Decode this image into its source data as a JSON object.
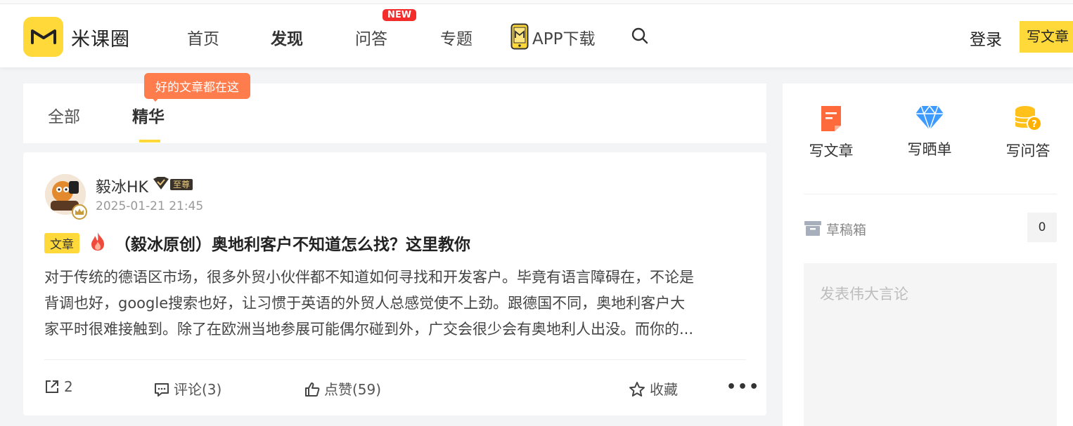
{
  "header": {
    "app_name": "米课圈",
    "nav": [
      "首页",
      "发现",
      "问答",
      "专题"
    ],
    "new_badge": "NEW",
    "app_download": "APP下载",
    "login": "登录",
    "write_button": "写文章"
  },
  "tabs": {
    "items": [
      "全部",
      "精华"
    ],
    "active": "精华",
    "tooltip": "好的文章都在这"
  },
  "post": {
    "author": "毅冰HK",
    "vip_badge": "至尊",
    "time": "2025-01-21 21:45",
    "tag": "文章",
    "title": "（毅冰原创）奥地利客户不知道怎么找？这里教你",
    "summary_lines": [
      "对于传统的德语区市场，很多外贸小伙伴都不知道如何寻找和开发客户。毕竟有语言障碍在，不论是",
      "背调也好，google搜索也好，让习惯于英语的外贸人总感觉使不上劲。跟德国不同，奥地利客户大",
      "家平时很难接触到。除了在欧洲当地参展可能偶尔碰到外，广交会很少会有奥地利人出没。而你的..."
    ],
    "share_count": "2",
    "comments": "评论(3)",
    "likes": "点赞(59)",
    "favorite": "收藏",
    "more": "•••"
  },
  "sidebar": {
    "quick_actions": [
      "写文章",
      "写晒单",
      "写问答"
    ],
    "drafts_label": "草稿箱",
    "drafts_count": "0",
    "compose_placeholder": "发表伟大言论"
  },
  "colors": {
    "brand_yellow": "#ffd93a",
    "badge_red": "#f42c2c",
    "tooltip_orange": "#ff7c4d",
    "fire_red": "#f04a3c"
  },
  "icons": {
    "logo": "m-mark-logo",
    "app": "phone-icon",
    "search": "search-icon",
    "share": "share-icon",
    "comment": "comment-icon",
    "like": "thumbs-up-icon",
    "favorite": "star-icon",
    "drafts": "archive-box-icon"
  }
}
